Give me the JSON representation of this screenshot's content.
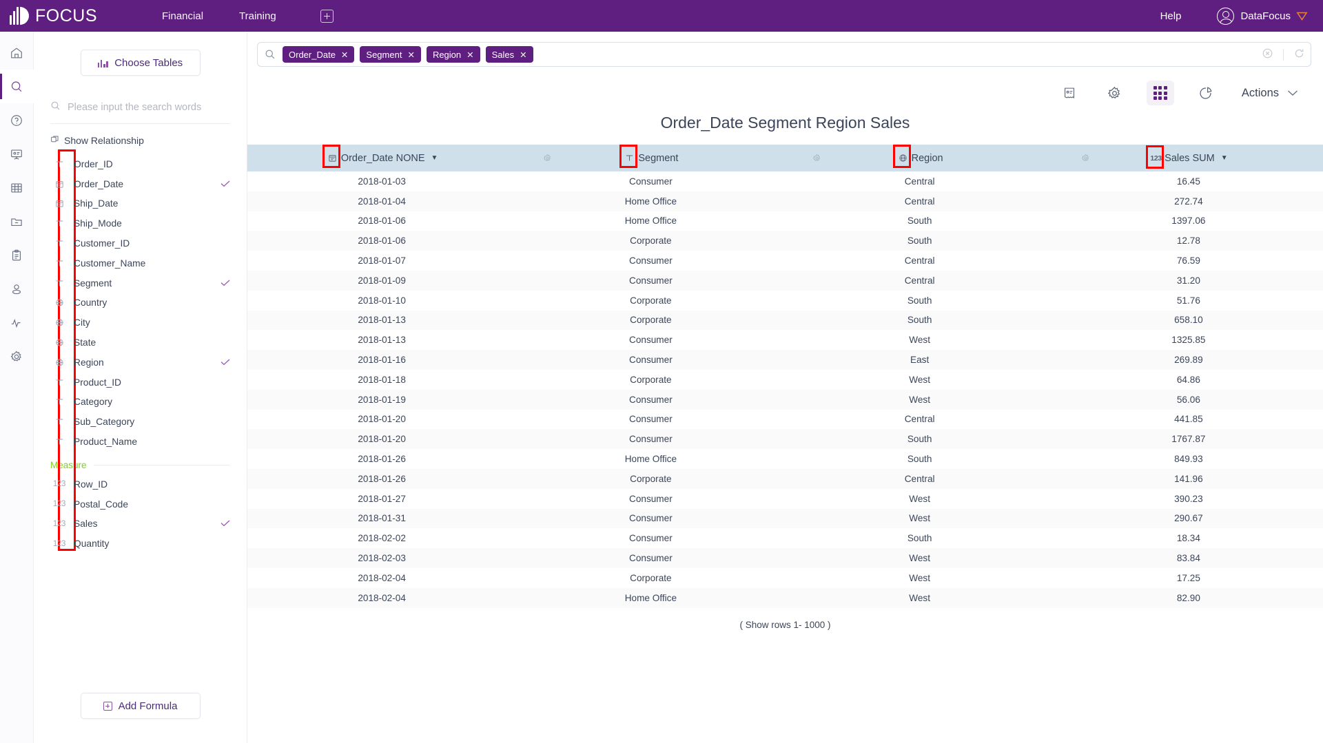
{
  "topbar": {
    "brand": "FOCUS",
    "nav": [
      {
        "label": "Financial",
        "name": "nav-financial"
      },
      {
        "label": "Training",
        "name": "nav-training"
      }
    ],
    "add_tab_icon": "plus-icon",
    "help": "Help",
    "user": "DataFocus",
    "accent": "#5e1f80"
  },
  "rail": {
    "items": [
      {
        "icon": "home-icon",
        "name": "rail-home",
        "active": false
      },
      {
        "icon": "search-icon",
        "name": "rail-search",
        "active": true
      },
      {
        "icon": "help-circle-icon",
        "name": "rail-help",
        "active": false
      },
      {
        "icon": "presentation-icon",
        "name": "rail-dashboard",
        "active": false
      },
      {
        "icon": "table-icon",
        "name": "rail-tables",
        "active": false
      },
      {
        "icon": "folder-minus-icon",
        "name": "rail-folder",
        "active": false
      },
      {
        "icon": "clipboard-icon",
        "name": "rail-clipboard",
        "active": false
      },
      {
        "icon": "user-icon",
        "name": "rail-user",
        "active": false
      },
      {
        "icon": "activity-icon",
        "name": "rail-activity",
        "active": false
      },
      {
        "icon": "gear-icon",
        "name": "rail-settings",
        "active": false
      }
    ]
  },
  "sidebar": {
    "choose_tables": "Choose Tables",
    "search_placeholder": "Please input the search words",
    "show_relationship": "Show Relationship",
    "measure_label": "Measure",
    "add_formula": "Add Formula",
    "attributes": [
      {
        "label": "Order_ID",
        "type": "text",
        "selected": false
      },
      {
        "label": "Order_Date",
        "type": "date",
        "selected": true
      },
      {
        "label": "Ship_Date",
        "type": "date",
        "selected": false
      },
      {
        "label": "Ship_Mode",
        "type": "text",
        "selected": false
      },
      {
        "label": "Customer_ID",
        "type": "text",
        "selected": false
      },
      {
        "label": "Customer_Name",
        "type": "text",
        "selected": false
      },
      {
        "label": "Segment",
        "type": "text",
        "selected": true
      },
      {
        "label": "Country",
        "type": "geo",
        "selected": false
      },
      {
        "label": "City",
        "type": "geo",
        "selected": false
      },
      {
        "label": "State",
        "type": "geo",
        "selected": false
      },
      {
        "label": "Region",
        "type": "geo",
        "selected": true
      },
      {
        "label": "Product_ID",
        "type": "text",
        "selected": false
      },
      {
        "label": "Category",
        "type": "text",
        "selected": false
      },
      {
        "label": "Sub_Category",
        "type": "text",
        "selected": false
      },
      {
        "label": "Product_Name",
        "type": "text",
        "selected": false
      }
    ],
    "measures": [
      {
        "label": "Row_ID",
        "type": "number",
        "selected": false
      },
      {
        "label": "Postal_Code",
        "type": "number",
        "selected": false
      },
      {
        "label": "Sales",
        "type": "number",
        "selected": true
      },
      {
        "label": "Quantity",
        "type": "number",
        "selected": false
      }
    ]
  },
  "search": {
    "tokens": [
      "Order_Date",
      "Segment",
      "Region",
      "Sales"
    ],
    "clear_icon": "clear-circle-icon",
    "refresh_icon": "refresh-icon"
  },
  "toolbar": {
    "buttons": [
      {
        "icon": "receipt-icon",
        "name": "toolbar-answer-note"
      },
      {
        "icon": "gear-icon",
        "name": "toolbar-settings"
      },
      {
        "icon": "grid-icon",
        "name": "toolbar-table-view",
        "active": true
      },
      {
        "icon": "pie-chart-icon",
        "name": "toolbar-chart-view"
      }
    ],
    "actions_label": "Actions"
  },
  "viz": {
    "title": "Order_Date Segment Region Sales",
    "rows_note": "( Show rows 1- 1000 )",
    "columns": [
      {
        "label": "Order_Date NONE",
        "type": "date",
        "caret": true,
        "annotated": true
      },
      {
        "label": "Segment",
        "type": "text",
        "caret": false,
        "annotated": true
      },
      {
        "label": "Region",
        "type": "geo",
        "caret": false,
        "annotated": true
      },
      {
        "label": "Sales SUM",
        "type": "number",
        "caret": true,
        "annotated": true
      }
    ],
    "rows": [
      [
        "2018-01-03",
        "Consumer",
        "Central",
        "16.45"
      ],
      [
        "2018-01-04",
        "Home Office",
        "Central",
        "272.74"
      ],
      [
        "2018-01-06",
        "Home Office",
        "South",
        "1397.06"
      ],
      [
        "2018-01-06",
        "Corporate",
        "South",
        "12.78"
      ],
      [
        "2018-01-07",
        "Consumer",
        "Central",
        "76.59"
      ],
      [
        "2018-01-09",
        "Consumer",
        "Central",
        "31.20"
      ],
      [
        "2018-01-10",
        "Corporate",
        "South",
        "51.76"
      ],
      [
        "2018-01-13",
        "Corporate",
        "South",
        "658.10"
      ],
      [
        "2018-01-13",
        "Consumer",
        "West",
        "1325.85"
      ],
      [
        "2018-01-16",
        "Consumer",
        "East",
        "269.89"
      ],
      [
        "2018-01-18",
        "Corporate",
        "West",
        "64.86"
      ],
      [
        "2018-01-19",
        "Consumer",
        "West",
        "56.06"
      ],
      [
        "2018-01-20",
        "Consumer",
        "Central",
        "441.85"
      ],
      [
        "2018-01-20",
        "Consumer",
        "South",
        "1767.87"
      ],
      [
        "2018-01-26",
        "Home Office",
        "South",
        "849.93"
      ],
      [
        "2018-01-26",
        "Corporate",
        "Central",
        "141.96"
      ],
      [
        "2018-01-27",
        "Consumer",
        "West",
        "390.23"
      ],
      [
        "2018-01-31",
        "Consumer",
        "West",
        "290.67"
      ],
      [
        "2018-02-02",
        "Consumer",
        "South",
        "18.34"
      ],
      [
        "2018-02-03",
        "Consumer",
        "West",
        "83.84"
      ],
      [
        "2018-02-04",
        "Corporate",
        "West",
        "17.25"
      ],
      [
        "2018-02-04",
        "Home Office",
        "West",
        "82.90"
      ]
    ]
  },
  "annotation": {
    "color": "#ff0000"
  }
}
